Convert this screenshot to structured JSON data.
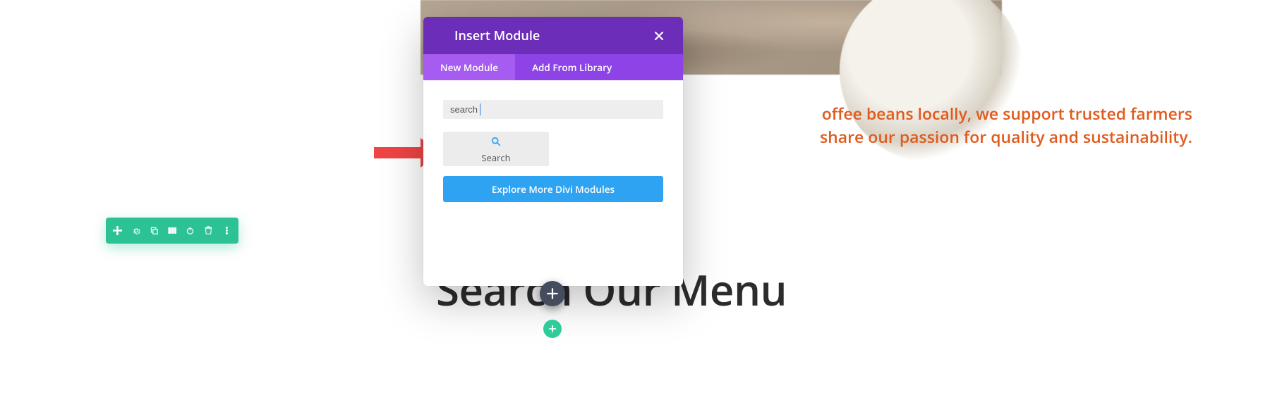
{
  "background": {
    "line1": "offee beans locally, we support trusted farmers",
    "line2": "share our passion for quality and sustainability."
  },
  "page": {
    "heading": "Search Our Menu"
  },
  "modal": {
    "title": "Insert Module",
    "tabs": [
      {
        "label": "New Module",
        "active": true
      },
      {
        "label": "Add From Library",
        "active": false
      }
    ],
    "search_value": "search",
    "module_result": {
      "label": "Search"
    },
    "explore_label": "Explore More Divi Modules"
  },
  "toolbar": {
    "icons": [
      "move-icon",
      "gear-icon",
      "duplicate-icon",
      "columns-icon",
      "power-icon",
      "trash-icon",
      "more-icon"
    ]
  }
}
